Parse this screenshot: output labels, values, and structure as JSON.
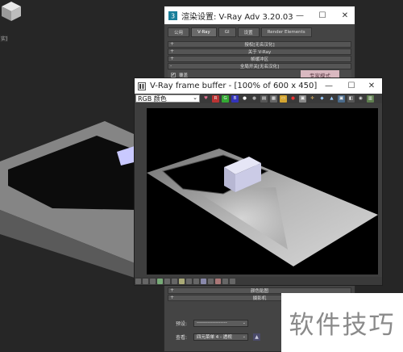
{
  "viewport": {
    "label": "实]"
  },
  "render_setup": {
    "title": "渲染设置: V-Ray Adv 3.20.03",
    "tabs": [
      {
        "label": "公用"
      },
      {
        "label": "V-Ray"
      },
      {
        "label": "GI"
      },
      {
        "label": "设置"
      },
      {
        "label": "Render Elements"
      }
    ],
    "rollouts": [
      {
        "label": "授权[无名汉化]"
      },
      {
        "label": "关于 V-Ray"
      },
      {
        "label": "帧缓冲区"
      },
      {
        "label": "全局开关[无名汉化]"
      }
    ],
    "override_label": "覆盖",
    "override_checked": "✔",
    "expert_mode": "专家模式",
    "bottom_rollouts": [
      {
        "label": "颜色贴图"
      },
      {
        "label": "摄影机"
      }
    ],
    "footer": {
      "preset_label": "预设:",
      "preset_value": "-------------------",
      "view_label": "查看:",
      "view_value": "四元菜单 4 - 透视"
    }
  },
  "vfb": {
    "title": "V-Ray frame buffer - [100% of 600 x 450]",
    "channel": "RGB 颜色"
  },
  "watermark": {
    "text": "软件技巧"
  },
  "colors": {
    "expert_button": "#d9b8c0",
    "titlebar": "#ffffff",
    "panel": "#444444"
  }
}
